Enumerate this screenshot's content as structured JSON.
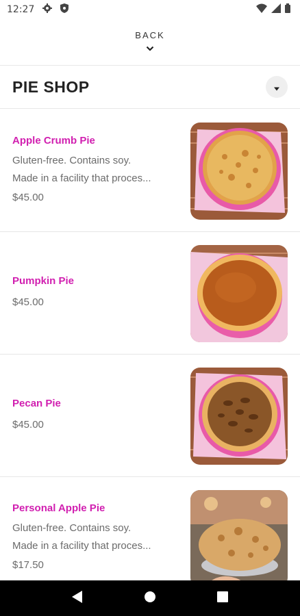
{
  "status_bar": {
    "time": "12:27",
    "icons": [
      "gear-icon",
      "shield-icon",
      "wifi-icon",
      "signal-icon",
      "battery-icon"
    ]
  },
  "back": {
    "label": "BACK"
  },
  "header": {
    "title": "PIE SHOP"
  },
  "items": [
    {
      "name": "Apple Crumb Pie",
      "desc_line1": "Gluten-free. Contains soy.",
      "desc_line2": "Made in a facility that proces...",
      "price": "$45.00"
    },
    {
      "name": "Pumpkin Pie",
      "desc_line1": "",
      "desc_line2": "",
      "price": "$45.00"
    },
    {
      "name": "Pecan Pie",
      "desc_line1": "",
      "desc_line2": "",
      "price": "$45.00"
    },
    {
      "name": "Personal Apple Pie",
      "desc_line1": "Gluten-free. Contains soy.",
      "desc_line2": "Made in a facility that proces...",
      "price": "$17.50"
    }
  ],
  "colors": {
    "accent": "#d11fb0",
    "text_muted": "#6b6b6b",
    "nav_bar": "#000000"
  },
  "nav": [
    "back-triangle-icon",
    "home-circle-icon",
    "recents-square-icon"
  ]
}
